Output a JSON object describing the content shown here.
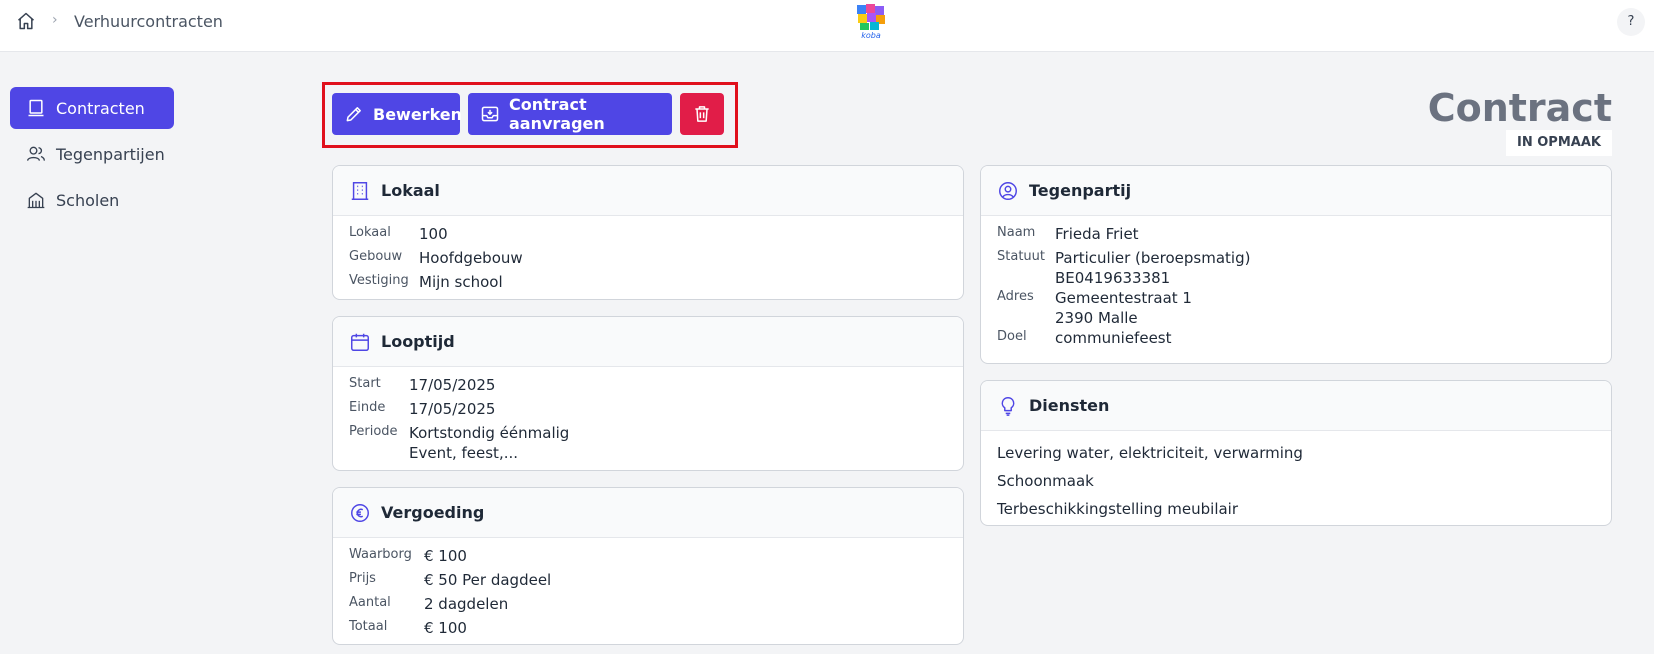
{
  "header": {
    "breadcrumb_current": "Verhuurcontracten",
    "help_label": "?",
    "logo_text": "koba"
  },
  "sidebar": {
    "items": [
      {
        "label": "Contracten",
        "icon": "document-icon",
        "active": true
      },
      {
        "label": "Tegenpartijen",
        "icon": "users-icon",
        "active": false
      },
      {
        "label": "Scholen",
        "icon": "school-icon",
        "active": false
      }
    ]
  },
  "toolbar": {
    "edit_label": "Bewerken",
    "request_label": "Contract aanvragen",
    "delete_icon": "trash-icon"
  },
  "page": {
    "title": "Contract",
    "status": "IN OPMAAK"
  },
  "cards": {
    "lokaal": {
      "title": "Lokaal",
      "rows": [
        {
          "label": "Lokaal",
          "value": "100"
        },
        {
          "label": "Gebouw",
          "value": "Hoofdgebouw"
        },
        {
          "label": "Vestiging",
          "value": "Mijn school"
        }
      ]
    },
    "looptijd": {
      "title": "Looptijd",
      "rows": [
        {
          "label": "Start",
          "value": "17/05/2025"
        },
        {
          "label": "Einde",
          "value": "17/05/2025"
        },
        {
          "label": "Periode",
          "value": "Kortstondig éénmalig",
          "value2": "Event, feest,..."
        }
      ]
    },
    "vergoeding": {
      "title": "Vergoeding",
      "rows": [
        {
          "label": "Waarborg",
          "value": "€ 100"
        },
        {
          "label": "Prijs",
          "value": "€ 50 Per dagdeel"
        },
        {
          "label": "Aantal",
          "value": "2 dagdelen"
        },
        {
          "label": "Totaal",
          "value": "€ 100"
        }
      ]
    },
    "tegenpartij": {
      "title": "Tegenpartij",
      "rows": [
        {
          "label": "Naam",
          "value": "Frieda Friet"
        },
        {
          "label": "Statuut",
          "value": "Particulier (beroepsmatig)",
          "value2": "BE0419633381"
        },
        {
          "label": "Adres",
          "value": "Gemeentestraat 1",
          "value2": "2390 Malle"
        },
        {
          "label": "Doel",
          "value": "communiefeest"
        }
      ]
    },
    "diensten": {
      "title": "Diensten",
      "items": [
        "Levering water, elektriciteit, verwarming",
        "Schoonmaak",
        "Terbeschikkingstelling meubilair"
      ]
    }
  },
  "colors": {
    "primary": "#4f46e5",
    "danger": "#e11d48",
    "highlight_frame": "#e0101c"
  }
}
